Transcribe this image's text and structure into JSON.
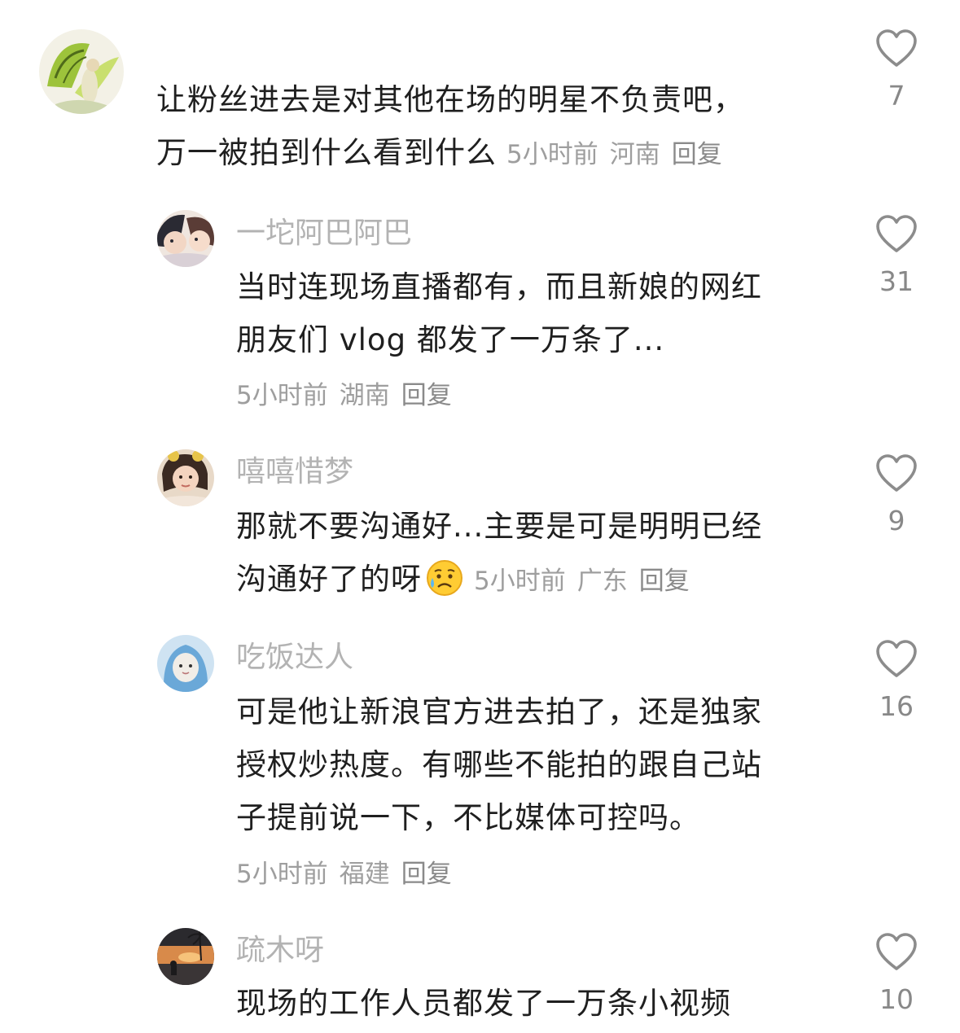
{
  "comments": [
    {
      "username": "",
      "lines": [
        "让粉丝进去是对其他在场的明星不负责吧，",
        "万一被拍到什么看到什么"
      ],
      "time": "5小时前",
      "location": "河南",
      "reply": "回复",
      "likes": "7",
      "avatar_icon": "butterfly-fairy-avatar"
    },
    {
      "username": "一坨阿巴阿巴",
      "lines": [
        "当时连现场直播都有，而且新娘的网红",
        "朋友们 vlog 都发了一万条了..."
      ],
      "time": "5小时前",
      "location": "湖南",
      "reply": "回复",
      "likes": "31",
      "avatar_icon": "anime-couple-avatar"
    },
    {
      "username": "嘻嘻惜梦",
      "lines": [
        "那就不要沟通好...主要是可是明明已经",
        "沟通好了的呀"
      ],
      "emoji": "sad-sweat-emoji-icon",
      "time": "5小时前",
      "location": "广东",
      "reply": "回复",
      "likes": "9",
      "avatar_icon": "girl-photo-avatar"
    },
    {
      "username": "吃饭达人",
      "lines": [
        "可是他让新浪官方进去拍了，还是独家",
        "授权炒热度。有哪些不能拍的跟自己站",
        "子提前说一下，不比媒体可控吗。"
      ],
      "time": "5小时前",
      "location": "福建",
      "reply": "回复",
      "likes": "16",
      "avatar_icon": "hooded-cat-avatar"
    },
    {
      "username": "疏木呀",
      "lines": [
        "现场的工作人员都发了一万条小视频"
      ],
      "time": "",
      "location": "",
      "reply": "",
      "likes": "10",
      "avatar_icon": "sunset-beach-avatar"
    }
  ],
  "icons": {
    "like": "heart-outline-icon",
    "accent_text": "#1f1f1f",
    "muted_text": "#9e9e9e",
    "username_color": "#b3b3b3"
  }
}
